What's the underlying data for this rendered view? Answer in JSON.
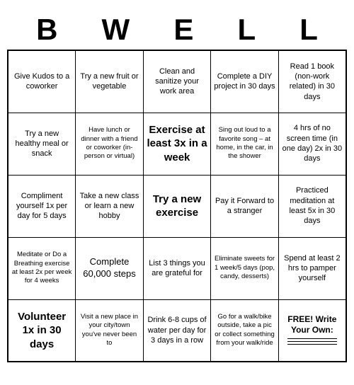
{
  "title": {
    "letters": [
      "B",
      "W",
      "E",
      "L",
      "L"
    ]
  },
  "grid": {
    "rows": [
      [
        {
          "text": "Give Kudos to a coworker",
          "size": "normal"
        },
        {
          "text": "Try a new fruit or vegetable",
          "size": "medium"
        },
        {
          "text": "Clean and sanitize your work area",
          "size": "normal"
        },
        {
          "text": "Complete a DIY project in 30 days",
          "size": "normal"
        },
        {
          "text": "Read 1 book (non-work related) in 30 days",
          "size": "normal"
        }
      ],
      [
        {
          "text": "Try a new healthy meal or snack",
          "size": "normal"
        },
        {
          "text": "Have lunch or dinner with a friend or coworker (in-person or virtual)",
          "size": "small"
        },
        {
          "text": "Exercise at least 3x in a week",
          "size": "large"
        },
        {
          "text": "Sing out loud to a favorite song – at home, in the car, in the shower",
          "size": "small"
        },
        {
          "text": "4 hrs of no screen time (in one day) 2x in 30 days",
          "size": "normal"
        }
      ],
      [
        {
          "text": "Compliment yourself 1x per day for 5 days",
          "size": "normal"
        },
        {
          "text": "Take a new class or learn a new hobby",
          "size": "normal"
        },
        {
          "text": "Try a new exercise",
          "size": "large"
        },
        {
          "text": "Pay it Forward to a stranger",
          "size": "normal"
        },
        {
          "text": "Practiced meditation at least 5x in 30 days",
          "size": "normal"
        }
      ],
      [
        {
          "text": "Meditate or Do a Breathing exercise at least 2x per week for 4 weeks",
          "size": "small"
        },
        {
          "text": "Complete 60,000 steps",
          "size": "medium"
        },
        {
          "text": "List 3 things you are grateful for",
          "size": "normal"
        },
        {
          "text": "Eliminate sweets for 1 week/5 days (pop, candy, desserts)",
          "size": "small"
        },
        {
          "text": "Spend at least 2 hrs to pamper yourself",
          "size": "normal"
        }
      ],
      [
        {
          "text": "Volunteer 1x in 30 days",
          "size": "large"
        },
        {
          "text": "Visit a new place in your city/town you've never been to",
          "size": "small"
        },
        {
          "text": "Drink 6-8 cups of water per day for 3 days in a row",
          "size": "normal"
        },
        {
          "text": "Go for a walk/bike outside, take a pic or collect something from your walk/ride",
          "size": "small"
        },
        {
          "text": "FREE! Write Your Own:",
          "size": "free"
        }
      ]
    ]
  }
}
